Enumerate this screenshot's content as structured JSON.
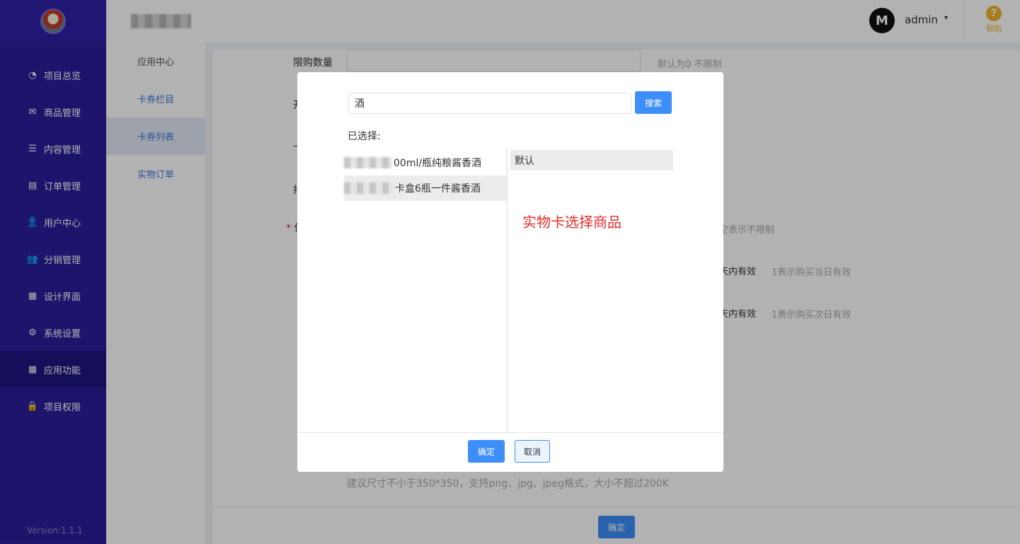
{
  "sidebar": {
    "items": [
      {
        "label": "项目总览",
        "icon": "pie-chart-icon",
        "glyph": "◔"
      },
      {
        "label": "商品管理",
        "icon": "envelope-icon",
        "glyph": "✉"
      },
      {
        "label": "内容管理",
        "icon": "list-icon",
        "glyph": "☰"
      },
      {
        "label": "订单管理",
        "icon": "document-icon",
        "glyph": "▤"
      },
      {
        "label": "用户中心",
        "icon": "user-icon",
        "glyph": "👤"
      },
      {
        "label": "分销管理",
        "icon": "users-icon",
        "glyph": "👥"
      },
      {
        "label": "设计界面",
        "icon": "layout-icon",
        "glyph": "▦"
      },
      {
        "label": "系统设置",
        "icon": "gear-icon",
        "glyph": "⚙"
      },
      {
        "label": "应用功能",
        "icon": "grid-icon",
        "glyph": "▦",
        "active": true
      },
      {
        "label": "项目权限",
        "icon": "lock-icon",
        "glyph": "🔒"
      }
    ],
    "version": "Version:1.1.1"
  },
  "header": {
    "avatar_text": "M",
    "user_name": "admin",
    "caret": "▾",
    "help_label": "帮助",
    "help_glyph": "?"
  },
  "subnav": {
    "items": [
      {
        "label": "应用中心"
      },
      {
        "label": "卡券栏目"
      },
      {
        "label": "卡券列表",
        "active": true
      },
      {
        "label": "实物订单"
      }
    ]
  },
  "form": {
    "limit_label": "限购数量",
    "limit_hint": "默认为0 不限制",
    "row2_label_partial": "开",
    "row3_label_partial": "卡",
    "row4_label_partial": "排",
    "row5_required": "*",
    "row5_label_partial": "使",
    "row5_hint": "空表示不限制",
    "row6_hint_a": "天内有效",
    "row6_hint_b": "1表示购买当日有效",
    "row7_hint_a": "天内有效",
    "row7_hint_b": "1表示购买次日有效",
    "image_hint": "建议尺寸不小于350*350，支持png、jpg、jpeg格式，大小不超过200K",
    "confirm_label": "确定"
  },
  "modal": {
    "search_value": "酒",
    "search_button": "搜索",
    "selected_label": "已选择:",
    "products": [
      {
        "visible_text": "00ml/瓶纯粮酱香酒"
      },
      {
        "visible_text": "卡盒6瓶一件酱香酒"
      }
    ],
    "spec_label": "默认",
    "annotation": "实物卡选择商品",
    "ok_label": "确定",
    "cancel_label": "取消"
  }
}
